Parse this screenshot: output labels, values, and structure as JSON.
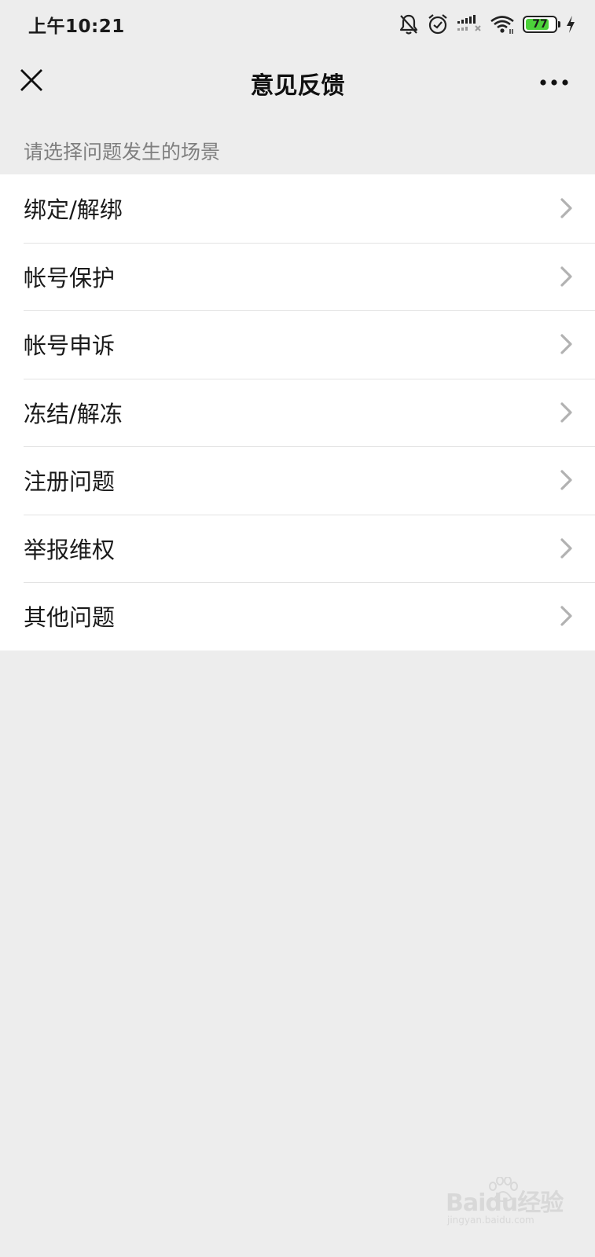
{
  "status_bar": {
    "time": "上午10:21",
    "battery_level": "77",
    "icons": [
      "bell-muted-icon",
      "alarm-icon",
      "signal-icon",
      "wifi-icon",
      "battery-icon",
      "charging-icon"
    ]
  },
  "nav": {
    "title": "意见反馈",
    "close_icon": "close-icon",
    "more_icon": "more-icon"
  },
  "section_hint": "请选择问题发生的场景",
  "scenes": [
    {
      "label": "绑定/解绑"
    },
    {
      "label": "帐号保护"
    },
    {
      "label": "帐号申诉"
    },
    {
      "label": "冻结/解冻"
    },
    {
      "label": "注册问题"
    },
    {
      "label": "举报维权"
    },
    {
      "label": "其他问题"
    }
  ],
  "watermark": {
    "brand": "Baidu经验",
    "sub": "jingyan.baidu.com"
  },
  "colors": {
    "background": "#ededed",
    "list_bg": "#ffffff",
    "hint_text": "#7f7f7f",
    "battery_fill": "#4cd13a"
  }
}
